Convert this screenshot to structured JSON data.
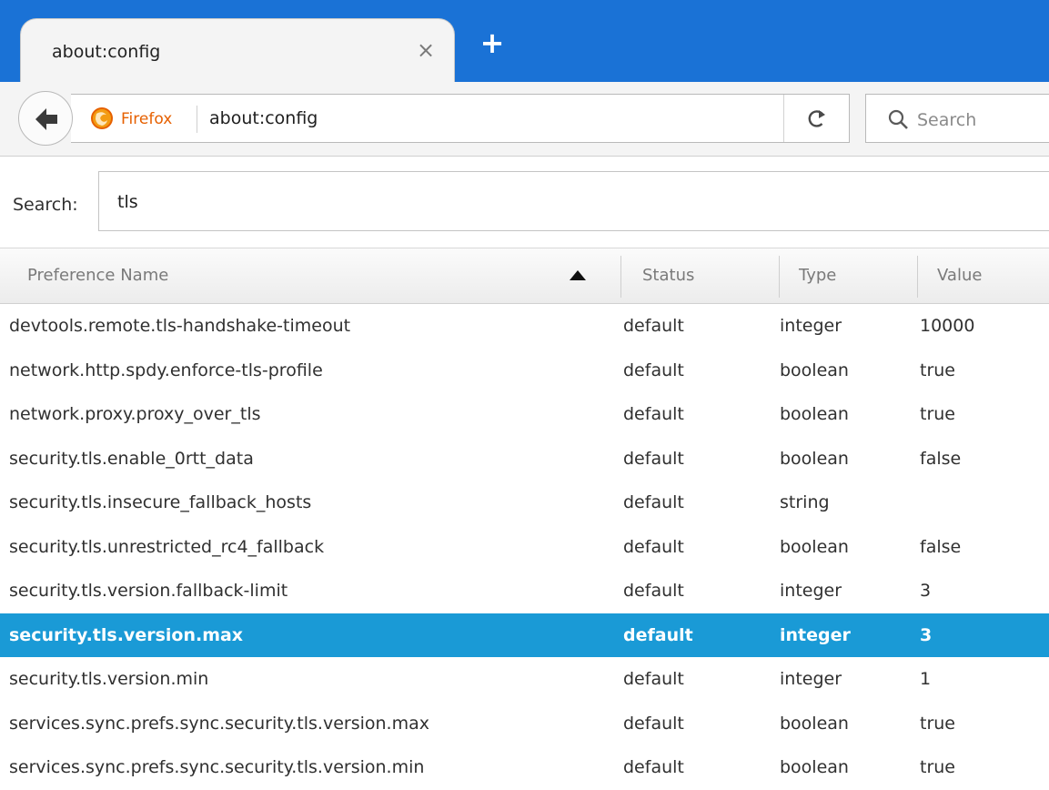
{
  "tab": {
    "title": "about:config",
    "close_glyph": "×",
    "newtab_glyph": "+"
  },
  "navbar": {
    "identity_label": "Firefox",
    "url": "about:config",
    "search_placeholder": "Search"
  },
  "filter": {
    "label": "Search:",
    "value": "tls"
  },
  "table": {
    "headers": {
      "name": "Preference Name",
      "status": "Status",
      "type": "Type",
      "value": "Value"
    },
    "rows": [
      {
        "name": "devtools.remote.tls-handshake-timeout",
        "status": "default",
        "type": "integer",
        "value": "10000"
      },
      {
        "name": "network.http.spdy.enforce-tls-profile",
        "status": "default",
        "type": "boolean",
        "value": "true"
      },
      {
        "name": "network.proxy.proxy_over_tls",
        "status": "default",
        "type": "boolean",
        "value": "true"
      },
      {
        "name": "security.tls.enable_0rtt_data",
        "status": "default",
        "type": "boolean",
        "value": "false"
      },
      {
        "name": "security.tls.insecure_fallback_hosts",
        "status": "default",
        "type": "string",
        "value": ""
      },
      {
        "name": "security.tls.unrestricted_rc4_fallback",
        "status": "default",
        "type": "boolean",
        "value": "false"
      },
      {
        "name": "security.tls.version.fallback-limit",
        "status": "default",
        "type": "integer",
        "value": "3"
      },
      {
        "name": "security.tls.version.max",
        "status": "default",
        "type": "integer",
        "value": "3"
      },
      {
        "name": "security.tls.version.min",
        "status": "default",
        "type": "integer",
        "value": "1"
      },
      {
        "name": "services.sync.prefs.sync.security.tls.version.max",
        "status": "default",
        "type": "boolean",
        "value": "true"
      },
      {
        "name": "services.sync.prefs.sync.security.tls.version.min",
        "status": "default",
        "type": "boolean",
        "value": "true"
      }
    ],
    "selected_row": 7
  },
  "colors": {
    "tabstrip": "#1a72d6",
    "selection": "#1a9ad6",
    "firefox_orange": "#e66000"
  },
  "icons": {
    "back": "back-arrow-icon",
    "firefox": "firefox-logo-icon",
    "reload": "reload-icon",
    "search": "magnifier-icon",
    "sort": "sort-ascending-icon"
  }
}
